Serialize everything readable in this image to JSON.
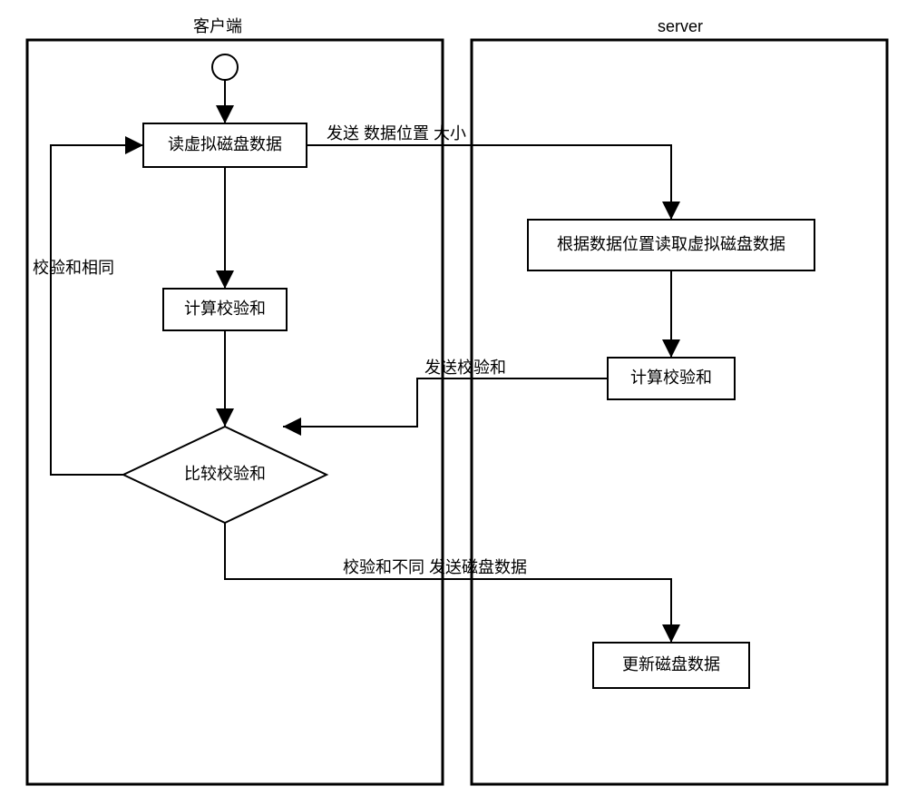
{
  "lanes": {
    "client": {
      "title": "客户端"
    },
    "server": {
      "title": "server"
    }
  },
  "nodes": {
    "read_vdisk": "读虚拟磁盘数据",
    "calc_checksum_client": "计算校验和",
    "compare_checksum": "比较校验和",
    "read_by_pos": "根据数据位置读取虚拟磁盘数据",
    "calc_checksum_server": "计算校验和",
    "update_disk": "更新磁盘数据"
  },
  "edges": {
    "send_pos_size": "发送 数据位置 大小",
    "checksum_same": "校验和相同",
    "send_checksum": "发送校验和",
    "checksum_diff_send_data": "校验和不同 发送磁盘数据"
  }
}
